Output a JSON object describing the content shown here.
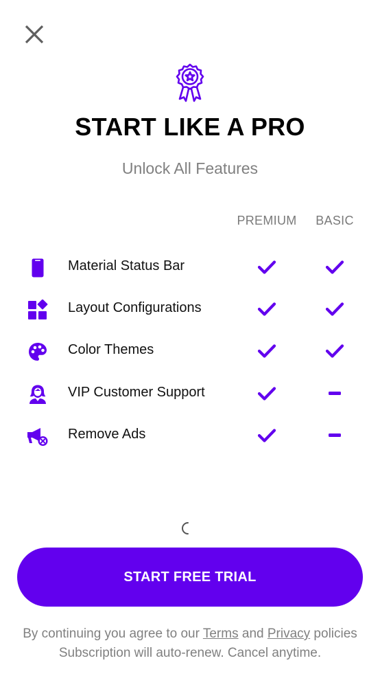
{
  "header": {
    "close_icon": "close-icon",
    "badge_icon": "award-badge-icon",
    "title": "START LIKE A PRO",
    "subtitle": "Unlock All Features"
  },
  "columns": {
    "premium": "PREMIUM",
    "basic": "BASIC"
  },
  "features": [
    {
      "icon": "phone-icon",
      "label": "Material Status Bar",
      "premium": "check",
      "basic": "check"
    },
    {
      "icon": "layout-grid-icon",
      "label": "Layout Configurations",
      "premium": "check",
      "basic": "check"
    },
    {
      "icon": "palette-icon",
      "label": "Color Themes",
      "premium": "check",
      "basic": "check"
    },
    {
      "icon": "support-agent-icon",
      "label": "VIP Customer Support",
      "premium": "check",
      "basic": "dash"
    },
    {
      "icon": "megaphone-off-icon",
      "label": "Remove Ads",
      "premium": "check",
      "basic": "dash"
    }
  ],
  "cta": {
    "label": "START FREE TRIAL"
  },
  "footer": {
    "line1_prefix": "By continuing you agree to our ",
    "terms_link": "Terms",
    "line1_and": " and ",
    "privacy_link": "Privacy",
    "line1_suffix": " policies",
    "line2": "Subscription will auto-renew. Cancel anytime."
  },
  "colors": {
    "accent": "#6200ee",
    "muted_text": "#808080"
  }
}
